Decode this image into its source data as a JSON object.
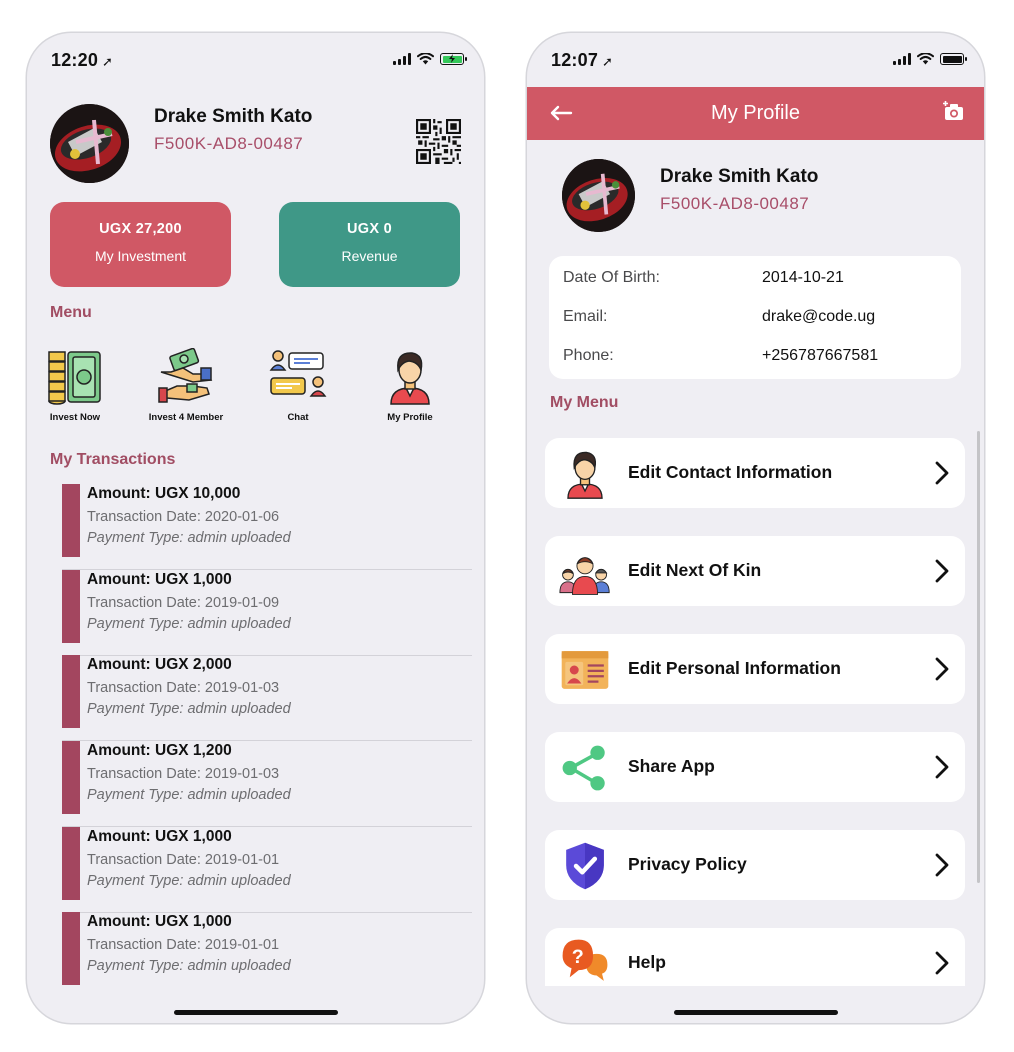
{
  "left": {
    "status": {
      "time": "12:20",
      "battery_color": "#34c759"
    },
    "user": {
      "name": "Drake Smith Kato",
      "id": "F500K-AD8-00487"
    },
    "cards": [
      {
        "amount": "UGX 27,200",
        "label": "My Investment",
        "color": "#d05865"
      },
      {
        "amount": "UGX 0",
        "label": "Revenue",
        "color": "#3f9887"
      }
    ],
    "menu_heading": "Menu",
    "menu": [
      {
        "label": "Invest Now",
        "icon": "cash-stack-icon"
      },
      {
        "label": "Invest 4 Member",
        "icon": "money-handshake-icon"
      },
      {
        "label": "Chat",
        "icon": "chat-people-icon"
      },
      {
        "label": "My Profile",
        "icon": "person-icon"
      }
    ],
    "transactions_heading": "My Transactions",
    "transactions": [
      {
        "amount": "Amount: UGX 10,000",
        "date": "Transaction Date: 2020-01-06",
        "type": "Payment Type: admin uploaded"
      },
      {
        "amount": "Amount: UGX 1,000",
        "date": "Transaction Date: 2019-01-09",
        "type": "Payment Type: admin uploaded"
      },
      {
        "amount": "Amount: UGX 2,000",
        "date": "Transaction Date: 2019-01-03",
        "type": "Payment Type: admin uploaded"
      },
      {
        "amount": "Amount: UGX 1,200",
        "date": "Transaction Date: 2019-01-03",
        "type": "Payment Type: admin uploaded"
      },
      {
        "amount": "Amount: UGX 1,000",
        "date": "Transaction Date: 2019-01-01",
        "type": "Payment Type: admin uploaded"
      },
      {
        "amount": "Amount: UGX 1,000",
        "date": "Transaction Date: 2019-01-01",
        "type": "Payment Type: admin uploaded"
      }
    ]
  },
  "right": {
    "status": {
      "time": "12:07"
    },
    "header": {
      "title": "My Profile",
      "color": "#d05865"
    },
    "user": {
      "name": "Drake Smith Kato",
      "id": "F500K-AD8-00487"
    },
    "info": [
      {
        "label": "Date Of Birth:",
        "value": "2014-10-21"
      },
      {
        "label": "Email:",
        "value": "drake@code.ug"
      },
      {
        "label": "Phone:",
        "value": "+256787667581"
      }
    ],
    "menu_heading": "My Menu",
    "menu": [
      {
        "label": "Edit Contact Information",
        "icon": "person-icon"
      },
      {
        "label": "Edit Next Of Kin",
        "icon": "family-icon"
      },
      {
        "label": "Edit Personal Information",
        "icon": "id-card-icon"
      },
      {
        "label": "Share App",
        "icon": "share-icon"
      },
      {
        "label": "Privacy Policy",
        "icon": "shield-check-icon"
      },
      {
        "label": "Help",
        "icon": "help-bubble-icon"
      }
    ]
  },
  "colors": {
    "accent": "#a14d63",
    "brand": "#d05865",
    "teal": "#3f9887",
    "transaction_bar": "#a3465f"
  }
}
